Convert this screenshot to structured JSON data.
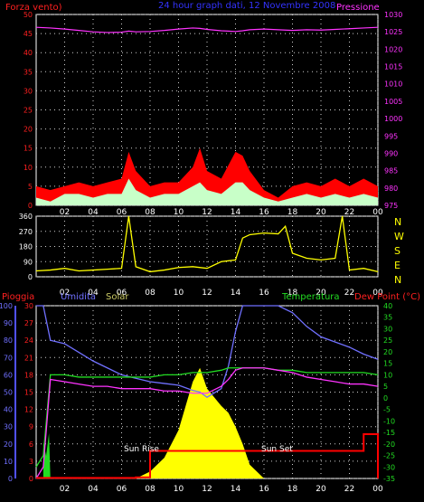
{
  "header": {
    "left_label": "Forza vento)",
    "center_label": "24 hour graph dati, 12 Novembre 2008",
    "right_label": "Pressione"
  },
  "bottom_header": {
    "pioggia": "Pioggia",
    "umidita": "Umidita",
    "solar": "Solar",
    "temperatura": "Temperatura",
    "dew_point": "Dew Point (°C)"
  },
  "direction_letters": [
    "N",
    "W",
    "S",
    "E",
    "N"
  ],
  "annotations": {
    "sun_rise": "Sun Rise",
    "sun_set": "Sun Set"
  },
  "x_ticks": [
    "02",
    "04",
    "06",
    "08",
    "10",
    "12",
    "14",
    "16",
    "18",
    "20",
    "22",
    "00"
  ],
  "colors": {
    "wind_gust": "#ff0000",
    "wind_avg": "#c8ffc8",
    "pressure": "#ff33ff",
    "direction": "#ffff00",
    "humidity": "#7070ff",
    "temperature": "#22dd22",
    "dew_point": "#ff33ff",
    "rain": "#ff0000",
    "solar": "#ffff00"
  },
  "chart_data": [
    {
      "type": "area",
      "title": "",
      "y_left": {
        "ylim": [
          0,
          50
        ],
        "ticks": [
          0,
          5,
          10,
          15,
          20,
          25,
          30,
          35,
          40,
          45,
          50
        ]
      },
      "y_right": {
        "ylim": [
          975,
          1030
        ],
        "ticks": [
          975,
          980,
          985,
          990,
          995,
          1000,
          1005,
          1010,
          1015,
          1020,
          1025,
          1030
        ]
      },
      "x_hours": [
        0,
        1,
        2,
        3,
        4,
        5,
        6,
        6.5,
        7,
        8,
        9,
        10,
        11,
        11.5,
        12,
        13,
        14,
        14.5,
        15,
        16,
        17,
        18,
        19,
        20,
        21,
        22,
        23,
        24
      ],
      "series": [
        {
          "name": "Forza vento",
          "values": [
            5,
            4,
            5,
            6,
            5,
            6,
            7,
            14,
            9,
            5,
            6,
            6,
            10,
            15,
            9,
            7,
            14,
            13,
            9,
            4,
            2,
            5,
            6,
            5,
            7,
            5,
            7,
            5
          ]
        },
        {
          "name": "",
          "values": [
            2,
            1,
            3,
            3,
            2,
            3,
            3,
            7,
            4,
            2,
            3,
            3,
            5,
            6,
            4,
            3,
            6,
            6,
            4,
            2,
            1,
            2,
            3,
            2,
            3,
            2,
            3,
            2
          ]
        },
        {
          "name": "Pressione",
          "values": [
            1026.3,
            1026.1,
            1025.8,
            1025.4,
            1025.0,
            1024.8,
            1024.9,
            1025.2,
            1025.0,
            1025.1,
            1025.4,
            1025.8,
            1026.1,
            1026.0,
            1025.7,
            1025.3,
            1025.1,
            1025.3,
            1025.6,
            1025.8,
            1025.6,
            1025.4,
            1025.6,
            1025.5,
            1025.7,
            1025.9,
            1026.1,
            1026.3
          ]
        }
      ]
    },
    {
      "type": "line",
      "title": "",
      "y_left": {
        "ylim": [
          0,
          360
        ],
        "ticks": [
          0,
          90,
          180,
          270,
          360
        ]
      },
      "x_hours": [
        0,
        1,
        2,
        3,
        4,
        5,
        6,
        6.5,
        7,
        8,
        9,
        10,
        11,
        12,
        13,
        14,
        14.5,
        15,
        16,
        17,
        17.5,
        18,
        19,
        20,
        21,
        21.5,
        22,
        23,
        24
      ],
      "series": [
        {
          "name": "",
          "values": [
            35,
            40,
            50,
            35,
            40,
            45,
            50,
            360,
            60,
            30,
            40,
            55,
            60,
            50,
            90,
            100,
            230,
            250,
            260,
            255,
            300,
            140,
            110,
            100,
            110,
            360,
            40,
            50,
            30
          ]
        }
      ]
    },
    {
      "type": "line",
      "title": "",
      "y_left": {
        "ylim": [
          0,
          100
        ],
        "ticks": [
          0,
          10,
          20,
          30,
          40,
          50,
          60,
          70,
          80,
          90,
          100
        ]
      },
      "y_left_inner": {
        "ylim": [
          0,
          30
        ],
        "ticks": [
          0,
          3,
          6,
          9,
          12,
          15,
          18,
          21,
          24,
          27,
          30
        ]
      },
      "y_right": {
        "ylim": [
          -35,
          40
        ],
        "ticks": [
          -35,
          -30,
          -25,
          -20,
          -15,
          -10,
          -5,
          0,
          5,
          10,
          15,
          20,
          25,
          30,
          35,
          40
        ]
      },
      "x_hours": [
        0,
        0.5,
        1,
        2,
        3,
        4,
        5,
        6,
        7,
        8,
        9,
        10,
        11,
        11.5,
        12,
        13,
        13.5,
        14,
        14.5,
        15,
        16,
        17,
        18,
        19,
        20,
        21,
        22,
        23,
        24
      ],
      "series": [
        {
          "name": "Umidita",
          "values": [
            100,
            100,
            80,
            78,
            73,
            68,
            64,
            60,
            58,
            56,
            55,
            54,
            51,
            50,
            47,
            52,
            65,
            85,
            100,
            100,
            100,
            100,
            96,
            88,
            82,
            79,
            76,
            72,
            69
          ]
        },
        {
          "name": "Solar",
          "values": [
            0,
            0,
            0,
            0,
            0,
            0,
            0,
            0,
            0,
            40,
            120,
            280,
            560,
            640,
            520,
            420,
            380,
            300,
            200,
            80,
            0,
            0,
            0,
            0,
            0,
            0,
            0,
            0,
            0
          ]
        },
        {
          "name": "Temperatura",
          "values": [
            -30,
            -25,
            10,
            10,
            9,
            9,
            9,
            9,
            9,
            9,
            10,
            10,
            11,
            11,
            11,
            12,
            13,
            13,
            13,
            13,
            13,
            12,
            12,
            11,
            11,
            11,
            11,
            11,
            10
          ]
        },
        {
          "name": "Dew Point (°C)",
          "values": [
            -35,
            -30,
            8,
            7,
            6,
            5,
            5,
            4,
            4,
            4,
            3,
            3,
            2,
            2,
            2,
            5,
            8,
            12,
            13,
            13,
            13,
            12,
            11,
            9,
            8,
            7,
            6,
            6,
            5
          ]
        },
        {
          "name": "Pioggia",
          "values": [
            0.1,
            0.1,
            0.1,
            0.1,
            0.1,
            0.1,
            0.1,
            0.1,
            0.2,
            4.8,
            4.8,
            4.8,
            4.8,
            4.8,
            4.8,
            4.8,
            4.8,
            4.8,
            4.8,
            4.8,
            4.8,
            4.8,
            4.8,
            4.8,
            4.8,
            4.8,
            4.8,
            7.7,
            7.7
          ]
        }
      ]
    }
  ]
}
